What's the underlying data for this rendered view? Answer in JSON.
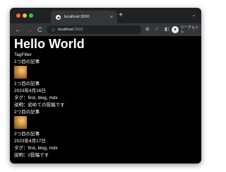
{
  "browser": {
    "tab_title": "localhost:3000",
    "tab_close": "×",
    "new_tab": "+",
    "tab_list": "⌄",
    "url_host": "localhost",
    "url_port": ":3000",
    "incognito_label": "シークレット",
    "menu": "⋮",
    "icons": [
      "back-arrow-icon",
      "forward-arrow-icon",
      "reload-icon",
      "info-icon",
      "translate-icon",
      "star-icon",
      "side-panel-icon",
      "incognito-icon",
      "more-icon"
    ]
  },
  "page": {
    "title": "Hello World",
    "filter_label": "TagFilter",
    "link_first": "1つ目の記事",
    "posts": [
      {
        "title": "1つ目の記事",
        "date": "2023年4月16日",
        "tags": "タグ：first, blog, mdx",
        "description": "説明：初めての投稿です",
        "next_link": "2つ目の記事"
      },
      {
        "title": "2つ目の記事",
        "date": "2023年4月17日",
        "tags": "タグ：first, blog, mdx",
        "description": "説明：2投稿です"
      }
    ]
  }
}
